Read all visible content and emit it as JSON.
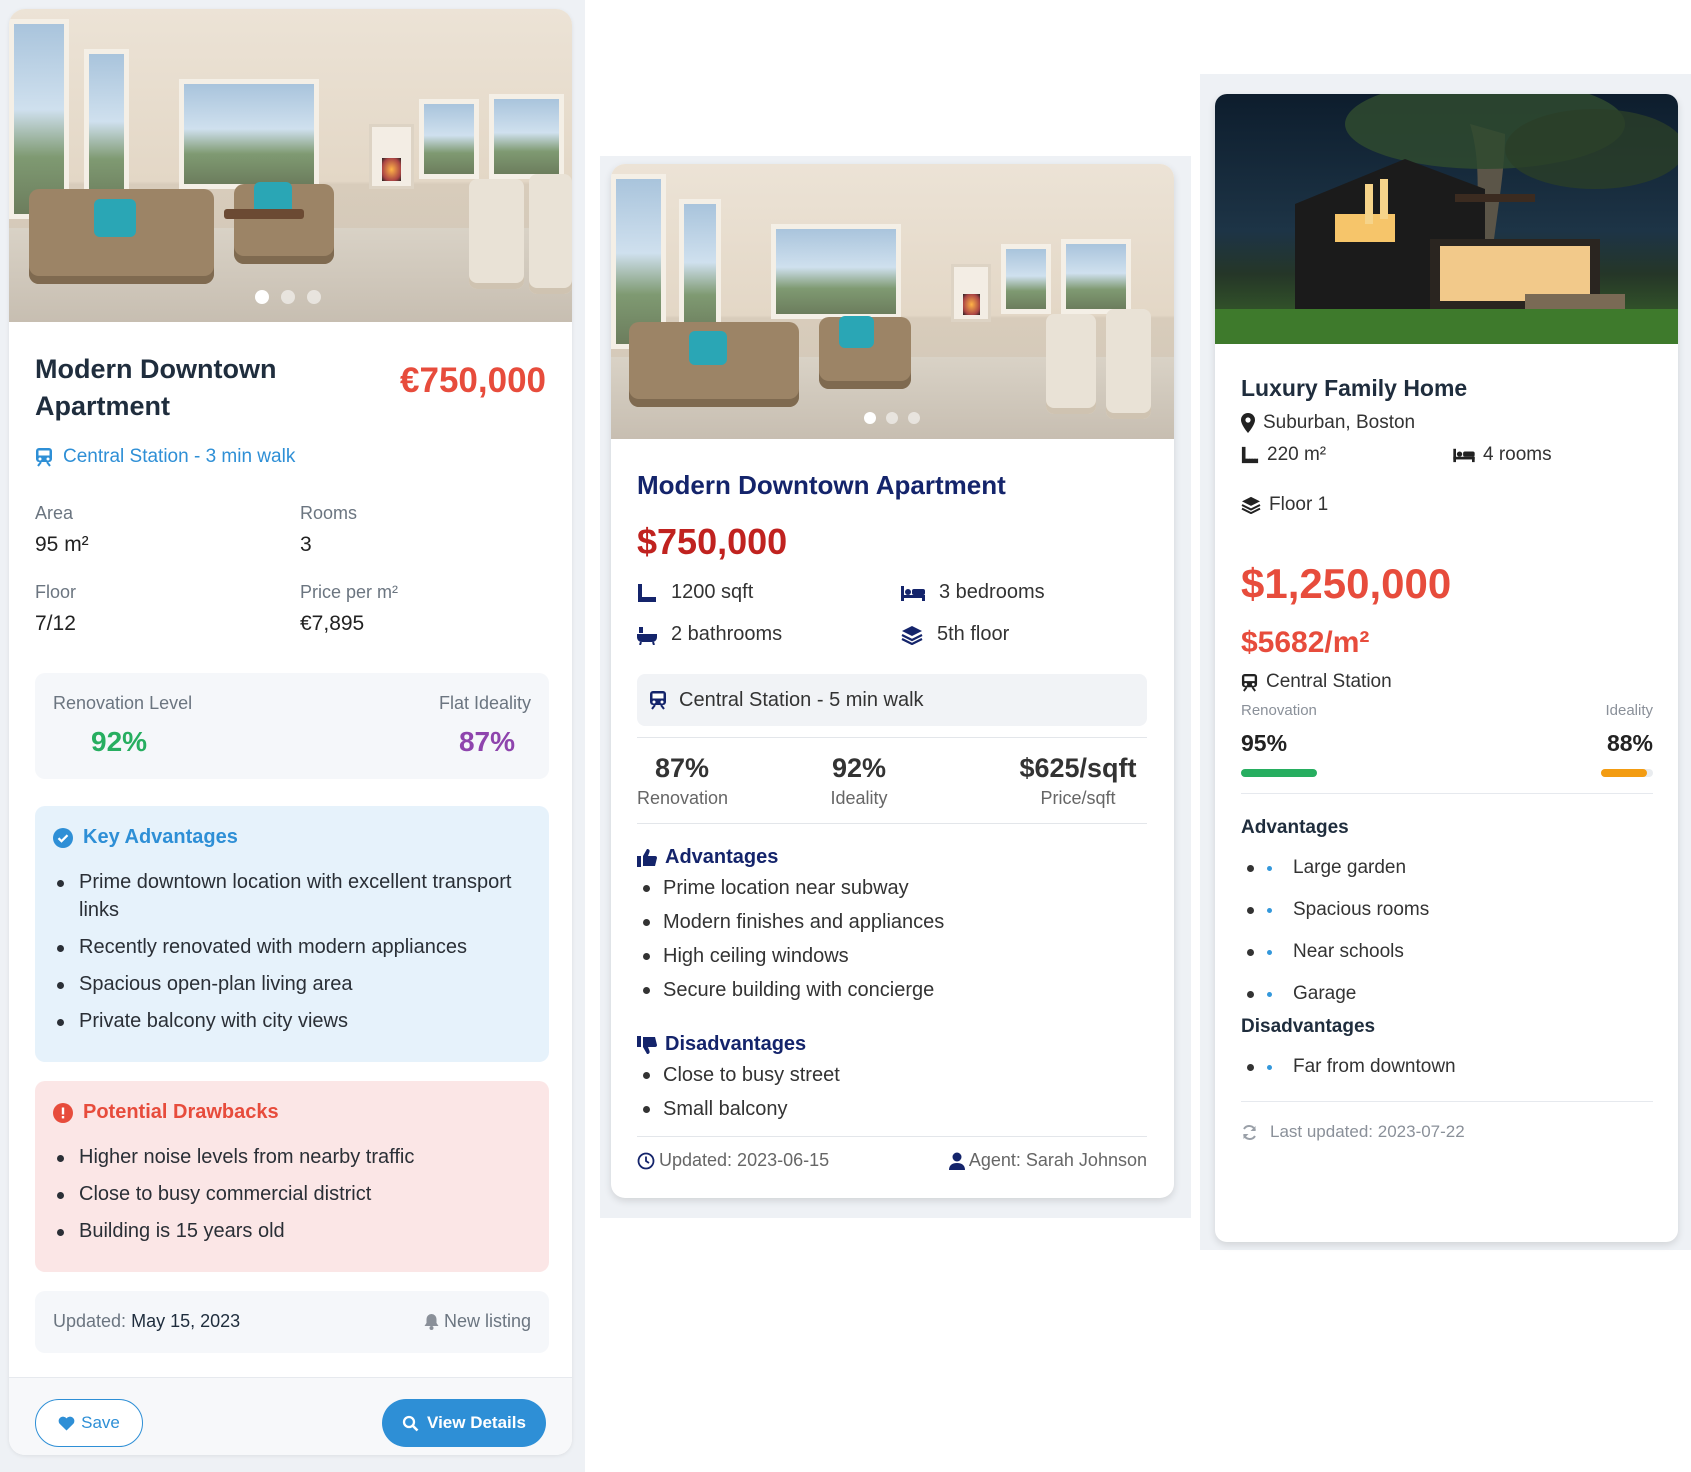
{
  "card1": {
    "title": "Modern Downtown Apartment",
    "price": "€750,000",
    "transit": "Central Station - 3 min walk",
    "specs": [
      {
        "label": "Area",
        "value": "95 m²"
      },
      {
        "label": "Rooms",
        "value": "3"
      },
      {
        "label": "Floor",
        "value": "7/12"
      },
      {
        "label": "Price per m²",
        "value": "€7,895"
      }
    ],
    "renovation_label": "Renovation Level",
    "renovation_value": "92%",
    "ideality_label": "Flat Ideality",
    "ideality_value": "87%",
    "advantages_title": "Key Advantages",
    "advantages": [
      "Prime downtown location with excellent transport links",
      "Recently renovated with modern appliances",
      "Spacious open-plan living area",
      "Private balcony with city views"
    ],
    "drawbacks_title": "Potential Drawbacks",
    "drawbacks": [
      "Higher noise levels from nearby traffic",
      "Close to busy commercial district",
      "Building is 15 years old"
    ],
    "updated_label": "Updated:",
    "updated_date": "May 15, 2023",
    "status_badge": "New listing",
    "save_label": "Save",
    "view_label": "View Details",
    "carousel_active": 1,
    "carousel_count": 3
  },
  "card2": {
    "title": "Modern Downtown Apartment",
    "price": "$750,000",
    "features": [
      {
        "icon": "ruler-icon",
        "text": "1200 sqft"
      },
      {
        "icon": "bed-icon",
        "text": "3 bedrooms"
      },
      {
        "icon": "bath-icon",
        "text": "2 bathrooms"
      },
      {
        "icon": "layers-icon",
        "text": "5th floor"
      }
    ],
    "transit": "Central Station - 5 min walk",
    "stats": [
      {
        "value": "87%",
        "label": "Renovation"
      },
      {
        "value": "92%",
        "label": "Ideality"
      },
      {
        "value": "$625/sqft",
        "label": "Price/sqft"
      }
    ],
    "advantages_title": "Advantages",
    "advantages": [
      "Prime location near subway",
      "Modern finishes and appliances",
      "High ceiling windows",
      "Secure building with concierge"
    ],
    "disadvantages_title": "Disadvantages",
    "disadvantages": [
      "Close to busy street",
      "Small balcony"
    ],
    "updated": "Updated: 2023-06-15",
    "agent": "Agent: Sarah Johnson",
    "carousel_active": 1,
    "carousel_count": 3
  },
  "card3": {
    "title": "Luxury Family Home",
    "location": "Suburban, Boston",
    "area": "220 m²",
    "rooms": "4 rooms",
    "floor": "Floor 1",
    "price": "$1,250,000",
    "price_per_m2": "$5682/m²",
    "transit": "Central Station",
    "renovation_label": "Renovation",
    "renovation_value": "95%",
    "renovation_fraction": 0.95,
    "ideality_label": "Ideality",
    "ideality_value": "88%",
    "ideality_fraction": 0.88,
    "advantages_title": "Advantages",
    "advantages": [
      "Large garden",
      "Spacious rooms",
      "Near schools",
      "Garage"
    ],
    "disadvantages_title": "Disadvantages",
    "disadvantages": [
      "Far from downtown"
    ],
    "last_updated": "Last updated: 2023-07-22"
  },
  "colors": {
    "accent_blue": "#2e8fd6",
    "price_red": "#e74c3c",
    "dark_red": "#c0221f",
    "navy": "#14246b",
    "green": "#27ae60",
    "purple": "#8e44ad",
    "orange": "#f39c12"
  }
}
